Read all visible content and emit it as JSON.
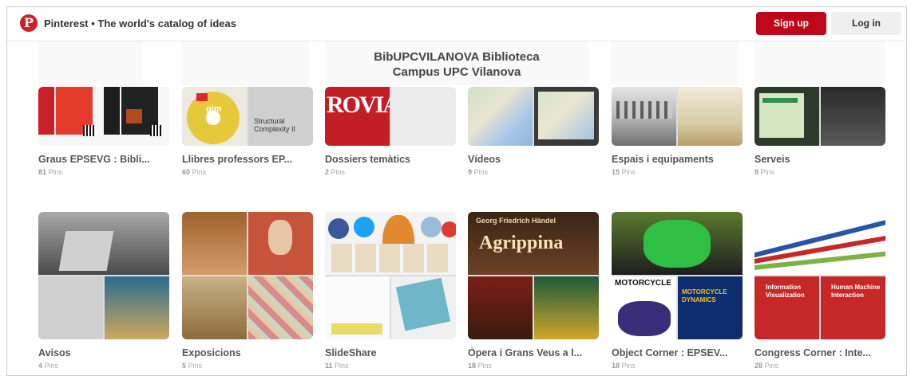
{
  "header": {
    "site_title": "Pinterest • The world's catalog of ideas",
    "signup_label": "Sign up",
    "login_label": "Log in",
    "brand_color": "#bd081c"
  },
  "profile": {
    "line1": "BibUPCVILANOVA Biblioteca",
    "line2": "Campus UPC Vilanova"
  },
  "boards": [
    {
      "title": "Graus EPSEVG : Bibli...",
      "count": "81",
      "pins_label": "Pins"
    },
    {
      "title": "Llibres professors EP...",
      "count": "60",
      "pins_label": "Pins"
    },
    {
      "title": "Dossiers temàtics",
      "count": "2",
      "pins_label": "Pins"
    },
    {
      "title": "Vídeos",
      "count": "9",
      "pins_label": "Pins"
    },
    {
      "title": "Espais i equipaments",
      "count": "15",
      "pins_label": "Pins"
    },
    {
      "title": "Serveis",
      "count": "8",
      "pins_label": "Pins"
    },
    {
      "title": "Avisos",
      "count": "4",
      "pins_label": "Pins"
    },
    {
      "title": "Exposicions",
      "count": "5",
      "pins_label": "Pins"
    },
    {
      "title": "SlideShare",
      "count": "11",
      "pins_label": "Pins"
    },
    {
      "title": "Òpera i Grans Veus a l...",
      "count": "18",
      "pins_label": "Pins"
    },
    {
      "title": "Object Corner : EPSEV...",
      "count": "18",
      "pins_label": "Pins"
    },
    {
      "title": "Congress Corner : Inte...",
      "count": "28",
      "pins_label": "Pins"
    }
  ],
  "cover_text": {
    "gim": "gim",
    "structural": "Structural Complexity II",
    "roviar": "ROVIAR",
    "agrippina": "Agrippina",
    "handel": "Georg Friedrich Händel",
    "motorcycle": "MOTORCYCLE",
    "motorcycle_dynamics": "MOTORCYCLE DYNAMICS",
    "info_vis": "Information Visualization",
    "hmi": "Human Machine Interaction"
  }
}
